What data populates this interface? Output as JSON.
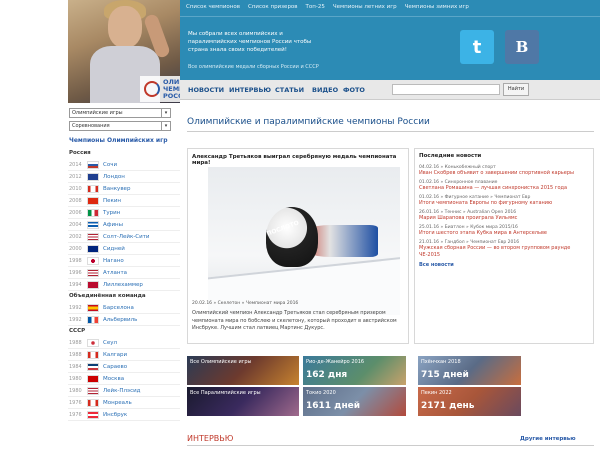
{
  "logo": {
    "text": "ОЛИМПИЙСКИЕ\nЧЕМПИОНЫ\nРОССИИ"
  },
  "topnav": [
    "Список чемпионов",
    "Список призеров",
    "Топ-25",
    "Чемпионы летних игр",
    "Чемпионы зимних игр"
  ],
  "tagline": "Мы собрали всех олимпийских и паралимпийских чемпионов России чтобы страна знала своих победителей!",
  "sub_tagline": "Все олимпийские медали сборных России и СССР",
  "social": {
    "twitter": "t",
    "vk": "В"
  },
  "mainnav": [
    "НОВОСТИ",
    "ИНТЕРВЬЮ",
    "СТАТЬИ",
    "ВИДЕО",
    "ФОТО"
  ],
  "search": {
    "placeholder": "",
    "button": "Найти"
  },
  "sidebar": {
    "select1": "Олимпийские игры",
    "select2": "Соревнования",
    "title": "Чемпионы Олимпийских игр",
    "groups": [
      {
        "name": "Россия",
        "rows": [
          {
            "year": "2014",
            "city": "Сочи",
            "flag": "ru"
          },
          {
            "year": "2012",
            "city": "Лондон",
            "flag": "gb"
          },
          {
            "year": "2010",
            "city": "Ванкувер",
            "flag": "ca"
          },
          {
            "year": "2008",
            "city": "Пекин",
            "flag": "cn"
          },
          {
            "year": "2006",
            "city": "Турин",
            "flag": "it"
          },
          {
            "year": "2004",
            "city": "Афины",
            "flag": "gr"
          },
          {
            "year": "2002",
            "city": "Солт-Лейк-Сити",
            "flag": "us"
          },
          {
            "year": "2000",
            "city": "Сидней",
            "flag": "au"
          },
          {
            "year": "1998",
            "city": "Нагано",
            "flag": "jp"
          },
          {
            "year": "1996",
            "city": "Атланта",
            "flag": "us"
          },
          {
            "year": "1994",
            "city": "Лиллехаммер",
            "flag": "no"
          }
        ]
      },
      {
        "name": "Объединённая команда",
        "rows": [
          {
            "year": "1992",
            "city": "Барселона",
            "flag": "es"
          },
          {
            "year": "1992",
            "city": "Альбервиль",
            "flag": "fr"
          }
        ]
      },
      {
        "name": "СССР",
        "rows": [
          {
            "year": "1988",
            "city": "Сеул",
            "flag": "kr"
          },
          {
            "year": "1988",
            "city": "Калгари",
            "flag": "ca"
          },
          {
            "year": "1984",
            "city": "Сараево",
            "flag": "yu"
          },
          {
            "year": "1980",
            "city": "Москва",
            "flag": "su"
          },
          {
            "year": "1980",
            "city": "Лейк-Плэсид",
            "flag": "us"
          },
          {
            "year": "1976",
            "city": "Монреаль",
            "flag": "ca"
          },
          {
            "year": "1976",
            "city": "Инсбрук",
            "flag": "at"
          }
        ]
      }
    ]
  },
  "page_title": "Олимпийские и паралимпийские чемпионы России",
  "feature": {
    "title": "Александр Третьяков выиграл серебряную медаль чемпионата мира!",
    "image_word": "ПОСЛОТО",
    "meta": "20.02.16 » Скелетон » Чемпионат мира 2016",
    "body": "Олимпийский чемпион Александр Третьяков стал серебряным призером чемпионата мира по бобслею и скелетону, который проходит в австрийском Инсбруке. Лучшим стал латвиец Мартинс Дукурс."
  },
  "news": {
    "header": "Последние новости",
    "items": [
      {
        "meta": "04.02.16 » Конькобежный спорт",
        "title": "Иван Скобрев объявит о завершении спортивной карьеры"
      },
      {
        "meta": "01.02.16 » Синхронное плавание",
        "title": "Светлана Ромашина — лучшая синхронистка 2015 года"
      },
      {
        "meta": "01.02.16 » Фигурное катание » Чемпионат Евр",
        "title": "Итоги чемпионата Европы по фигурному катанию"
      },
      {
        "meta": "26.01.16 » Теннис » Australian Open 2016",
        "title": "Мария Шарапова проиграла Уильямс"
      },
      {
        "meta": "25.01.16 » Биатлон » Кубок мира 2015/16",
        "title": "Итоги шестого этапа Кубка мира в Антерсельве"
      },
      {
        "meta": "21.01.16 » Гандбол » Чемпионат Евр 2016",
        "title": "Мужская сборная России — во втором групповом раунде ЧЕ-2015"
      }
    ],
    "all_label": "Все новости"
  },
  "tiles": {
    "all_olympic": {
      "label": "Все Олимпийские игры",
      "value": ""
    },
    "rio": {
      "label": "Рио-де-Жанейро 2016",
      "value": "162 дня"
    },
    "pyeongchang": {
      "label": "Пхёнчхан 2018",
      "value": "715 дней"
    },
    "all_para": {
      "label": "Все Паралимпийские игры",
      "value": ""
    },
    "tokyo": {
      "label": "Токио 2020",
      "value": "1611 дней"
    },
    "beijing": {
      "label": "Пекин 2022",
      "value": "2171 день"
    }
  },
  "interview": {
    "header": "ИНТЕРВЬЮ",
    "other_label": "Другие интервью"
  },
  "colors": {
    "header_blue": "#2c8bb5",
    "link_blue": "#2a6fb5",
    "accent_red": "#c0392b",
    "twitter": "#3cb3e6",
    "vk": "#4f78a6"
  }
}
